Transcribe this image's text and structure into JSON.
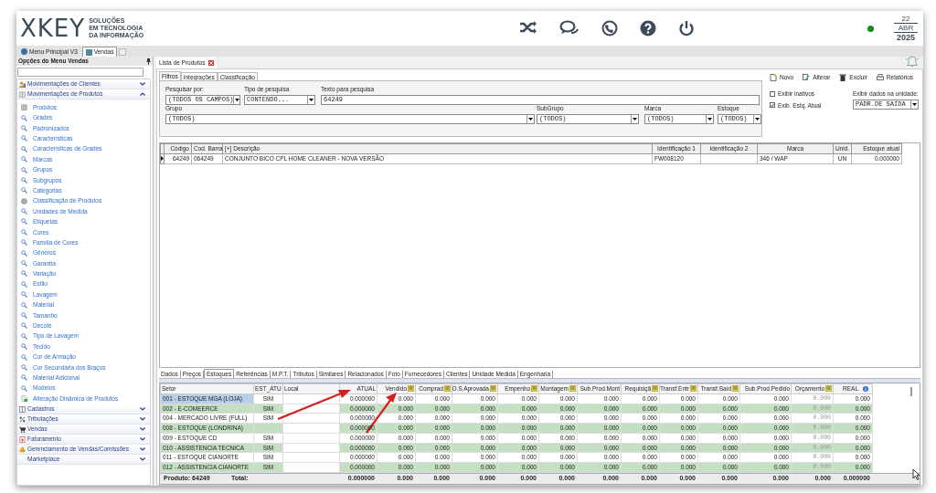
{
  "brand": {
    "logo": "XKEY",
    "tagline": [
      "SOLUÇÕES",
      "EM TECNOLOGIA",
      "DA INFORMAÇÃO"
    ]
  },
  "date": {
    "day": "22",
    "month": "ABR",
    "year": "2025"
  },
  "window_tabs": [
    {
      "label": "Menu Principal V3",
      "selected": false
    },
    {
      "label": "Vendas",
      "selected": true
    }
  ],
  "sidebar": {
    "title": "Opções do Menu Vendas",
    "groups": [
      {
        "label": "Movimentações de Clientes",
        "expanded": false
      },
      {
        "label": "Movimentações de Produtos",
        "expanded": true,
        "children": [
          {
            "label": "Produtos",
            "kind": "grid"
          },
          {
            "label": "Grades",
            "kind": "search"
          },
          {
            "label": "Padronizados",
            "kind": "search"
          },
          {
            "label": "Características",
            "kind": "search"
          },
          {
            "label": "Características de Grades",
            "kind": "search"
          },
          {
            "label": "Marcas",
            "kind": "search"
          },
          {
            "label": "Grupos",
            "kind": "search"
          },
          {
            "label": "Subgrupos",
            "kind": "search"
          },
          {
            "label": "Categorias",
            "kind": "search"
          },
          {
            "label": "Classificação de Produtos",
            "kind": "disc"
          },
          {
            "label": "Unidades de Medida",
            "kind": "search"
          },
          {
            "label": "Etiquetas",
            "kind": "search"
          },
          {
            "label": "Cores",
            "kind": "search"
          },
          {
            "label": "Família de Cores",
            "kind": "search"
          },
          {
            "label": "Gêneros",
            "kind": "search"
          },
          {
            "label": "Garantia",
            "kind": "search"
          },
          {
            "label": "Variação",
            "kind": "search"
          },
          {
            "label": "Estilo",
            "kind": "search"
          },
          {
            "label": "Lavagem",
            "kind": "search"
          },
          {
            "label": "Material",
            "kind": "search"
          },
          {
            "label": "Tamanho",
            "kind": "search"
          },
          {
            "label": "Decote",
            "kind": "search"
          },
          {
            "label": "Tipo de Lavagem",
            "kind": "search"
          },
          {
            "label": "Tecido",
            "kind": "search"
          },
          {
            "label": "Cor de Armação",
            "kind": "search"
          },
          {
            "label": "Cor Secundária dos Braços",
            "kind": "search"
          },
          {
            "label": "Material Adicional",
            "kind": "search"
          },
          {
            "label": "Modelos",
            "kind": "search"
          },
          {
            "label": "Alteração Dinâmica de Produtos",
            "kind": "doc"
          }
        ]
      },
      {
        "label": "Cadastros",
        "expanded": false
      },
      {
        "label": "Tributações",
        "expanded": false
      },
      {
        "label": "Vendas",
        "expanded": false
      },
      {
        "label": "Faturamento",
        "expanded": false
      },
      {
        "label": "Gerenciamento de Vendas/Comissões",
        "expanded": false
      },
      {
        "label": "Marketplace",
        "expanded": false
      }
    ]
  },
  "document_tab": {
    "label": "Lista de Produtos"
  },
  "filter_tabs": [
    {
      "label": "Filtros",
      "selected": true
    },
    {
      "label": "Integrações",
      "selected": false
    },
    {
      "label": "Classificação",
      "selected": false
    }
  ],
  "filters": {
    "pesquisar_por": {
      "label": "Pesquisar por:",
      "value": "(TODOS OS CAMPOS)"
    },
    "tipo": {
      "label": "Tipo de pesquisa",
      "value": "CONTENDO..."
    },
    "texto": {
      "label": "Texto para pesquisa",
      "value": "64249"
    },
    "grupo": {
      "label": "Grupo",
      "value": "(TODOS)"
    },
    "subgrupo": {
      "label": "SubGrupo",
      "value": "(TODOS)"
    },
    "marca": {
      "label": "Marca",
      "value": "(TODOS)"
    },
    "estoque": {
      "label": "Estoque",
      "value": "(TODOS)"
    }
  },
  "actions": [
    {
      "label": "Novo",
      "kind": "new"
    },
    {
      "label": "Alterar",
      "kind": "edit"
    },
    {
      "label": "Excluir",
      "kind": "delete"
    },
    {
      "label": "Relatórios",
      "kind": "print"
    }
  ],
  "options": [
    {
      "label": "Exibir inativos",
      "checked": false
    },
    {
      "label": "Exib. Estq. Atual",
      "checked": true
    }
  ],
  "unit": {
    "label": "Exibir dados na unidade:",
    "value": "PADR.DE SAÍDA"
  },
  "products": {
    "columns": [
      "Código",
      "Cod. Barra",
      "[+] Descrição",
      "Identificação 1",
      "Identificação 2",
      "Marca",
      "Unid.",
      "Estoque atual"
    ],
    "rows": [
      {
        "cells": [
          "64249",
          "064249",
          "CONJUNTO BICO CPL HOME CLEANER - NOVA VERSÃO",
          "FW008120",
          "",
          "346 / WAP",
          "UN",
          "0.000000"
        ],
        "selected": true
      }
    ]
  },
  "detail_tabs": [
    {
      "label": "Dados",
      "selected": false
    },
    {
      "label": "Preços",
      "selected": false
    },
    {
      "label": "Estoques",
      "selected": true
    },
    {
      "label": "Referências",
      "selected": false
    },
    {
      "label": "M.P.T.",
      "selected": false
    },
    {
      "label": "Tributos",
      "selected": false
    },
    {
      "label": "Similares",
      "selected": false
    },
    {
      "label": "Relacionados",
      "selected": false
    },
    {
      "label": "Foto",
      "selected": false
    },
    {
      "label": "Fornecedores",
      "selected": false
    },
    {
      "label": "Clientes",
      "selected": false
    },
    {
      "label": "Unidade Medida",
      "selected": false
    },
    {
      "label": "Engenharia",
      "selected": false
    }
  ],
  "stock": {
    "columns": [
      {
        "label": "Setor",
        "kind": "plain"
      },
      {
        "label": "EST_ATU",
        "kind": "plain"
      },
      {
        "label": "Local",
        "kind": "plain"
      },
      {
        "label": "ATUAL",
        "kind": "plain"
      },
      {
        "label": "Vendido",
        "kind": "filter"
      },
      {
        "label": "Comprad",
        "kind": "filter"
      },
      {
        "label": "O.S Aprovada",
        "kind": "filter"
      },
      {
        "label": "Empenho",
        "kind": "filter"
      },
      {
        "label": "Montagem",
        "kind": "filter"
      },
      {
        "label": "Sub.Prod.Mont",
        "kind": "plain"
      },
      {
        "label": "Requisiçã",
        "kind": "filter"
      },
      {
        "label": "Transf.Entr",
        "kind": "filter"
      },
      {
        "label": "Transf.Saíd",
        "kind": "filter"
      },
      {
        "label": "Sub.Prod.Pedido",
        "kind": "plain"
      },
      {
        "label": "Orçamento",
        "kind": "filter"
      },
      {
        "label": "REAL",
        "kind": "info"
      }
    ],
    "rows": [
      {
        "setor": "001 - ESTOQUE MGA (LOJA)",
        "est_atu": "SIM",
        "selected": true,
        "values": [
          "0.000000",
          "0.000",
          "0.000",
          "0.000",
          "0.000",
          "0.000",
          "0.000",
          "0.000",
          "0.000",
          "0.000",
          "0.000",
          "0.000",
          "0.000"
        ]
      },
      {
        "setor": "002 - E-COMEERCE",
        "est_atu": "SIM",
        "selected": false,
        "values": [
          "0.000000",
          "0.000",
          "0.000",
          "0.000",
          "0.000",
          "0.000",
          "0.000",
          "0.000",
          "0.000",
          "0.000",
          "0.000",
          "0.000",
          "0.000"
        ]
      },
      {
        "setor": "004 - MERCADO LIVRE (FULL)",
        "est_atu": "SIM",
        "selected": false,
        "values": [
          "0.000000",
          "0.000",
          "0.000",
          "0.000",
          "0.000",
          "0.000",
          "0.000",
          "0.000",
          "0.000",
          "0.000",
          "0.000",
          "0.000",
          "0.000"
        ]
      },
      {
        "setor": "008 - ESTOQUE (LONDRINA)",
        "selected": false,
        "values": [
          "0.000000",
          "0.000",
          "0.000",
          "0.000",
          "0.000",
          "0.000",
          "0.000",
          "0.000",
          "0.000",
          "0.000",
          "0.000",
          "0.000",
          "0.000"
        ]
      },
      {
        "setor": "009 - ESTOQUE CD",
        "est_atu": "SIM",
        "selected": false,
        "values": [
          "0.000000",
          "0.000",
          "0.000",
          "0.000",
          "0.000",
          "0.000",
          "0.000",
          "0.000",
          "0.000",
          "0.000",
          "0.000",
          "0.000",
          "0.000"
        ]
      },
      {
        "setor": "010 - ASSISTENCIA TECNICA",
        "est_atu": "SIM",
        "selected": false,
        "values": [
          "0.000000",
          "0.000",
          "0.000",
          "0.000",
          "0.000",
          "0.000",
          "0.000",
          "0.000",
          "0.000",
          "0.000",
          "0.000",
          "0.000",
          "0.000"
        ]
      },
      {
        "setor": "011 - ESTOQUE CIANORTE",
        "est_atu": "SIM",
        "selected": false,
        "values": [
          "0.000000",
          "0.000",
          "0.000",
          "0.000",
          "0.000",
          "0.000",
          "0.000",
          "0.000",
          "0.000",
          "0.000",
          "0.000",
          "0.000",
          "0.000"
        ]
      },
      {
        "setor": "012 - ASSISTENCIA CIANORTE",
        "est_atu": "SIM",
        "selected": false,
        "values": [
          "0.000000",
          "0.000",
          "0.000",
          "0.000",
          "0.000",
          "0.000",
          "0.000",
          "0.000",
          "0.000",
          "0.000",
          "0.000",
          "0.000",
          "0.000"
        ]
      }
    ],
    "footer": {
      "produto": "Produto: 64249",
      "total_label": "Total:",
      "totals": [
        "0.000000",
        "0.000",
        "0.000",
        "0.000",
        "0.000",
        "0.000",
        "0.000",
        "0.000",
        "0.000",
        "0.000",
        "0.000",
        "0.000",
        "0.000000"
      ]
    }
  }
}
